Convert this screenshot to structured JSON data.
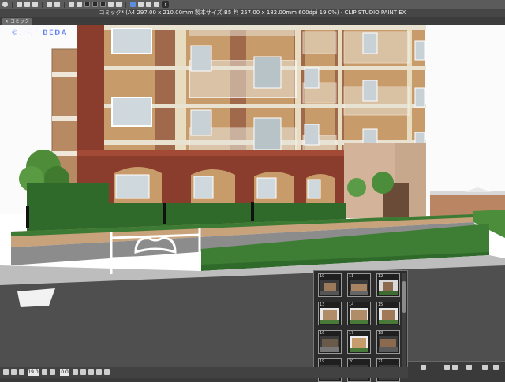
{
  "toolbar": {
    "icons": [
      "eye-icon",
      "new-file-icon",
      "open-icon",
      "save-icon",
      "undo-icon",
      "redo-icon",
      "clear-icon",
      "fill-icon",
      "select-all-icon",
      "deselect-icon",
      "invert-selection-icon",
      "crop-icon",
      "transform-icon",
      "camera-icon",
      "snap-icon",
      "ruler-icon",
      "grid-icon",
      "help-icon"
    ],
    "help_label": "?"
  },
  "title": "コミック* (A4 297.00 x 210.00mm 製本サイズ:B5 判 257.00 x 182.00mm 600dpi 19.0%) - CLIP STUDIO PAINT EX",
  "doc_tab": {
    "close": "×",
    "label": "コミック"
  },
  "canvas": {
    "overlay_title": "©ぼんぽBEDA"
  },
  "thumbnails": [
    {
      "num": "10"
    },
    {
      "num": "11"
    },
    {
      "num": "12"
    },
    {
      "num": "13"
    },
    {
      "num": "14"
    },
    {
      "num": "15"
    },
    {
      "num": "16"
    },
    {
      "num": "17"
    },
    {
      "num": "18"
    },
    {
      "num": "19"
    },
    {
      "num": "20"
    },
    {
      "num": "21"
    }
  ],
  "status": {
    "zoom": "19.0",
    "angle": "0.0"
  },
  "colors": {
    "brick": "#8a3d2c",
    "facade": "#c89b6a",
    "hedge": "#2f6a2a",
    "road": "#4f4f4f",
    "accent": "#5f7cf0"
  }
}
